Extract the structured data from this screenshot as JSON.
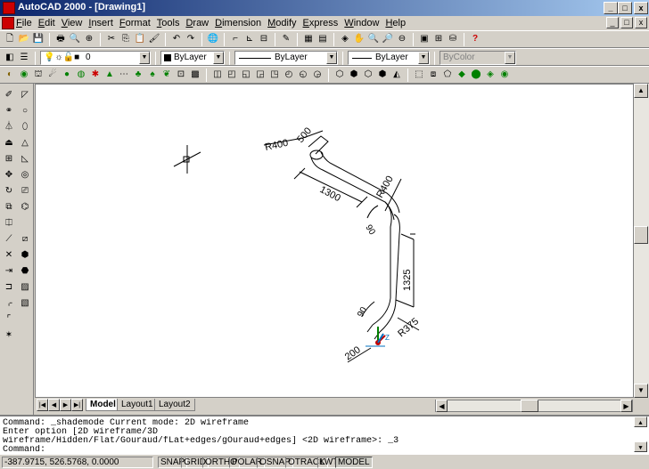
{
  "window": {
    "title": "AutoCAD 2000 - [Drawing1]",
    "controls": [
      "_",
      "□",
      "x"
    ],
    "doc_controls": [
      "_",
      "□",
      "x"
    ]
  },
  "menu": {
    "items": [
      "File",
      "Edit",
      "View",
      "Insert",
      "Format",
      "Tools",
      "Draw",
      "Dimension",
      "Modify",
      "Express",
      "Window",
      "Help"
    ]
  },
  "toolbar2": {
    "layer_value": "0",
    "color_value": "ByLayer",
    "linetype_value": "ByLayer",
    "lineweight_value": "ByLayer",
    "plotstyle_value": "ByColor"
  },
  "drawing": {
    "labels": {
      "r400_top": "R400",
      "l500": "500",
      "l1300": "1300",
      "r400_mid": "R400",
      "a90_mid": "90",
      "l1325": "1325",
      "a90_bottom": "90",
      "r375": "R375",
      "l200": "200"
    },
    "ucs_z": "Z"
  },
  "tabs": {
    "model": "Model",
    "layout1": "Layout1",
    "layout2": "Layout2"
  },
  "command": {
    "lines": [
      "Command: _shademode Current mode: 2D wireframe",
      "Enter option [2D wireframe/3D",
      "wireframe/Hidden/Flat/Gouraud/fLat+edges/gOuraud+edges] <2D wireframe>: _3",
      "Command:"
    ]
  },
  "status": {
    "coords": "-387.9715, 526.5768, 0.0000",
    "snap": "SNAP",
    "grid": "GRID",
    "ortho": "ORTHO",
    "polar": "POLAR",
    "osnap": "OSNAP",
    "otrack": "OTRACK",
    "lwt": "LWT",
    "model": "MODEL"
  },
  "colors": {
    "titlebar_start": "#0a246a",
    "titlebar_end": "#a6caf0",
    "ucs_x": "#c00000",
    "ucs_y": "#008000",
    "ucs_z": "#0070c0"
  }
}
